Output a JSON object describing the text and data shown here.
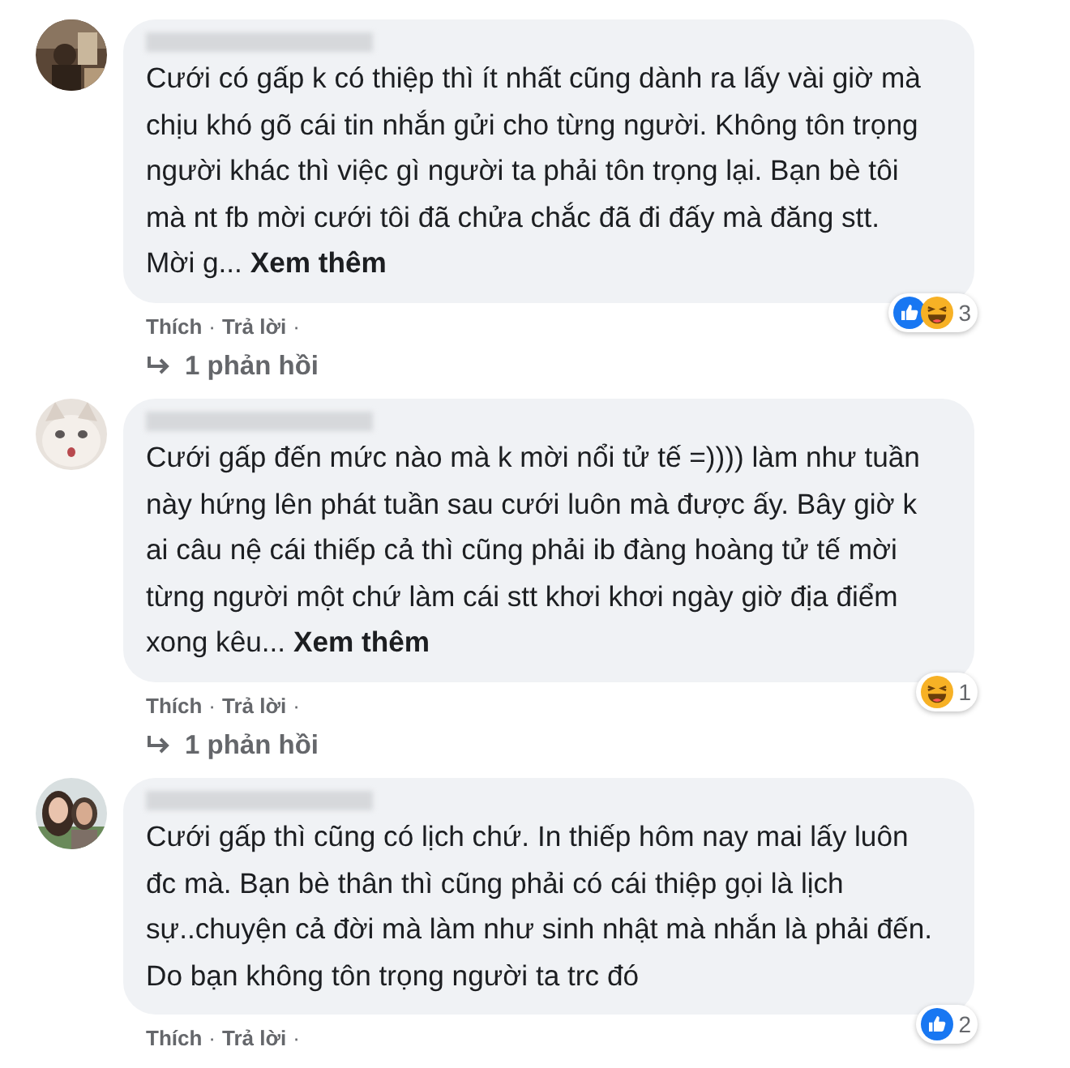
{
  "separator": "·",
  "comments": [
    {
      "avatar": {
        "kind": "picture"
      },
      "text": "Cưới có gấp k có thiệp thì ít nhất cũng dành ra lấy vài giờ mà chịu khó gõ cái tin nhắn gửi cho từng người. Không tôn trọng người khác thì việc gì người ta phải tôn trọng lại. Bạn bè tôi mà nt fb mời cưới tôi đã chửa chắc đã đi đấy mà đăng stt. Mời g...",
      "see_more": "Xem thêm",
      "reactions": [
        {
          "kind": "like"
        },
        {
          "kind": "haha"
        }
      ],
      "reaction_count": "3",
      "actions": [
        "Thích",
        "Trả lời"
      ],
      "replies": "1 phản hồi"
    },
    {
      "avatar": {
        "kind": "picture"
      },
      "text": "Cưới gấp đến mức nào mà k mời nổi tử tế =)))) làm như tuần này hứng lên phát tuần sau cưới luôn mà được ấy. Bây giờ k ai câu nệ cái thiếp cả thì cũng phải ib đàng hoàng tử tế mời từng người một chứ làm cái stt khơi khơi ngày giờ địa điểm xong kêu...",
      "see_more": "Xem thêm",
      "reactions": [
        {
          "kind": "haha"
        }
      ],
      "reaction_count": "1",
      "actions": [
        "Thích",
        "Trả lời"
      ],
      "replies": "1 phản hồi"
    },
    {
      "avatar": {
        "kind": "picture"
      },
      "text": "Cưới gấp thì cũng có lịch chứ. In thiếp hôm nay mai lấy luôn đc mà. Bạn bè thân thì cũng phải có cái thiệp gọi là lịch sự..chuyện cả đời mà làm như sinh nhật mà nhắn là phải đến. Do bạn không tôn trọng người ta trc đó",
      "reactions": [
        {
          "kind": "like"
        }
      ],
      "reaction_count": "2",
      "actions": [
        "Thích",
        "Trả lời"
      ]
    }
  ]
}
